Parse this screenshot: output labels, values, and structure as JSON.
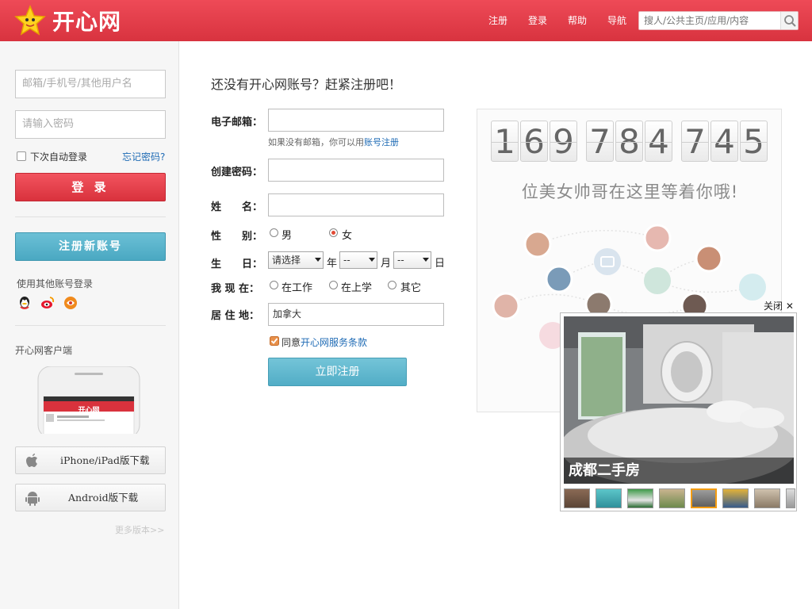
{
  "header": {
    "logo_text": "开心网",
    "nav": [
      "注册",
      "登录",
      "帮助",
      "导航"
    ],
    "search_placeholder": "搜人/公共主页/应用/内容",
    "brand_color": "#e0404b"
  },
  "sidebar": {
    "username_placeholder": "邮箱/手机号/其他用户名",
    "password_placeholder": "请输入密码",
    "remember_label": "下次自动登录",
    "forgot_label": "忘记密码?",
    "login_button": "登 录",
    "register_button": "注册新账号",
    "other_login_label": "使用其他账号登录",
    "social_icons": [
      "qq-icon",
      "weibo-icon",
      "third-party-icon"
    ],
    "client_label": "开心网客户端",
    "phone_screen_title": "开心网",
    "downloads": [
      {
        "label": "iPhone/iPad版下载",
        "icon": "apple-icon"
      },
      {
        "label": "Android版下载",
        "icon": "android-icon"
      }
    ],
    "more_versions": "更多版本>>"
  },
  "form": {
    "heading": "还没有开心网账号？赶紧注册吧！",
    "email_label": "电子邮箱：",
    "email_hint_prefix": "如果没有邮箱，你可以用",
    "email_hint_link": "账号注册",
    "password_label": "创建密码：",
    "name_label": "姓　　名：",
    "gender_label": "性　　别：",
    "gender_options": [
      "男",
      "女"
    ],
    "gender_selected": "女",
    "birthday_label": "生　　日：",
    "birthday_year_value": "请选择",
    "birthday_year_unit": "年",
    "birthday_month_value": "--",
    "birthday_month_unit": "月",
    "birthday_day_value": "--",
    "birthday_day_unit": "日",
    "status_label": "我 现 在：",
    "status_options": [
      "在工作",
      "在上学",
      "其它"
    ],
    "residence_label": "居 住 地：",
    "residence_value": "加拿大",
    "agree_prefix": "同意",
    "agree_link": "开心网服务条款",
    "submit_button": "立即注册"
  },
  "panel": {
    "counter_digits": [
      "1",
      "6",
      "9",
      "7",
      "8",
      "4",
      "7",
      "4",
      "5"
    ],
    "slogan": "位美女帅哥在这里等着你哦!"
  },
  "ad": {
    "close_label": "关闭",
    "caption": "成都二手房"
  }
}
